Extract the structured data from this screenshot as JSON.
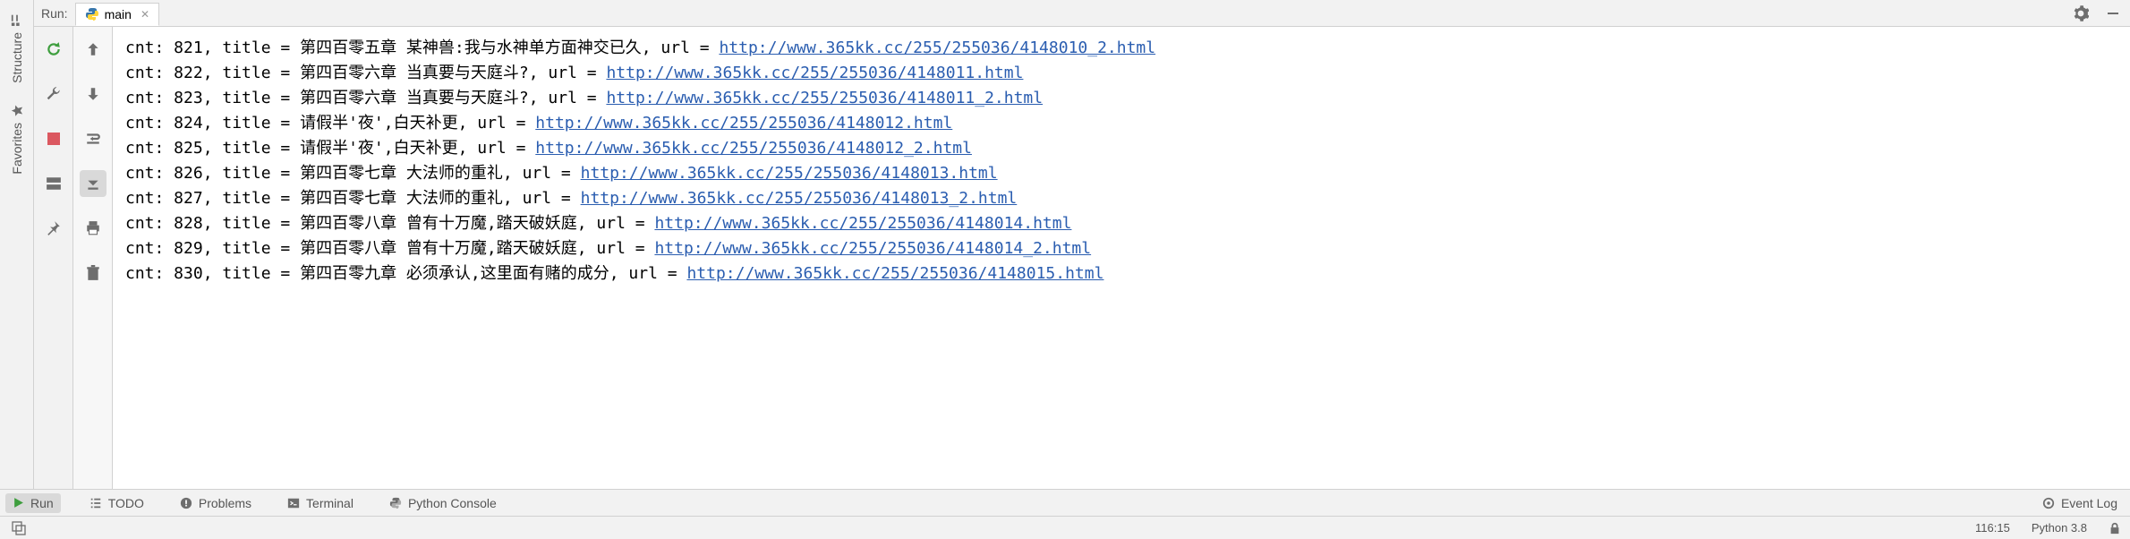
{
  "header": {
    "run_label": "Run:",
    "tab_name": "main"
  },
  "left_tabs": {
    "structure": "Structure",
    "favorites": "Favorites"
  },
  "console_lines": [
    {
      "cnt": 821,
      "title": "第四百零五章 某神兽:我与水神单方面神交已久",
      "url": "http://www.365kk.cc/255/255036/4148010_2.html"
    },
    {
      "cnt": 822,
      "title": "第四百零六章 当真要与天庭斗?",
      "url": "http://www.365kk.cc/255/255036/4148011.html"
    },
    {
      "cnt": 823,
      "title": "第四百零六章 当真要与天庭斗?",
      "url": "http://www.365kk.cc/255/255036/4148011_2.html"
    },
    {
      "cnt": 824,
      "title": "请假半'夜',白天补更",
      "url": "http://www.365kk.cc/255/255036/4148012.html"
    },
    {
      "cnt": 825,
      "title": "请假半'夜',白天补更",
      "url": "http://www.365kk.cc/255/255036/4148012_2.html"
    },
    {
      "cnt": 826,
      "title": "第四百零七章 大法师的重礼",
      "url": "http://www.365kk.cc/255/255036/4148013.html"
    },
    {
      "cnt": 827,
      "title": "第四百零七章 大法师的重礼",
      "url": "http://www.365kk.cc/255/255036/4148013_2.html"
    },
    {
      "cnt": 828,
      "title": "第四百零八章 曾有十万魔,踏天破妖庭",
      "url": "http://www.365kk.cc/255/255036/4148014.html"
    },
    {
      "cnt": 829,
      "title": "第四百零八章 曾有十万魔,踏天破妖庭",
      "url": "http://www.365kk.cc/255/255036/4148014_2.html"
    },
    {
      "cnt": 830,
      "title": "第四百零九章 必须承认,这里面有赌的成分",
      "url": "http://www.365kk.cc/255/255036/4148015.html"
    }
  ],
  "line_template": {
    "prefix": "cnt: ",
    "title_sep": ", title = ",
    "url_sep": ", url = "
  },
  "bottom_tabs": {
    "run": "Run",
    "todo": "TODO",
    "problems": "Problems",
    "terminal": "Terminal",
    "python_console": "Python Console",
    "event_log": "Event Log"
  },
  "status": {
    "cursor": "116:15",
    "interpreter": "Python 3.8"
  }
}
